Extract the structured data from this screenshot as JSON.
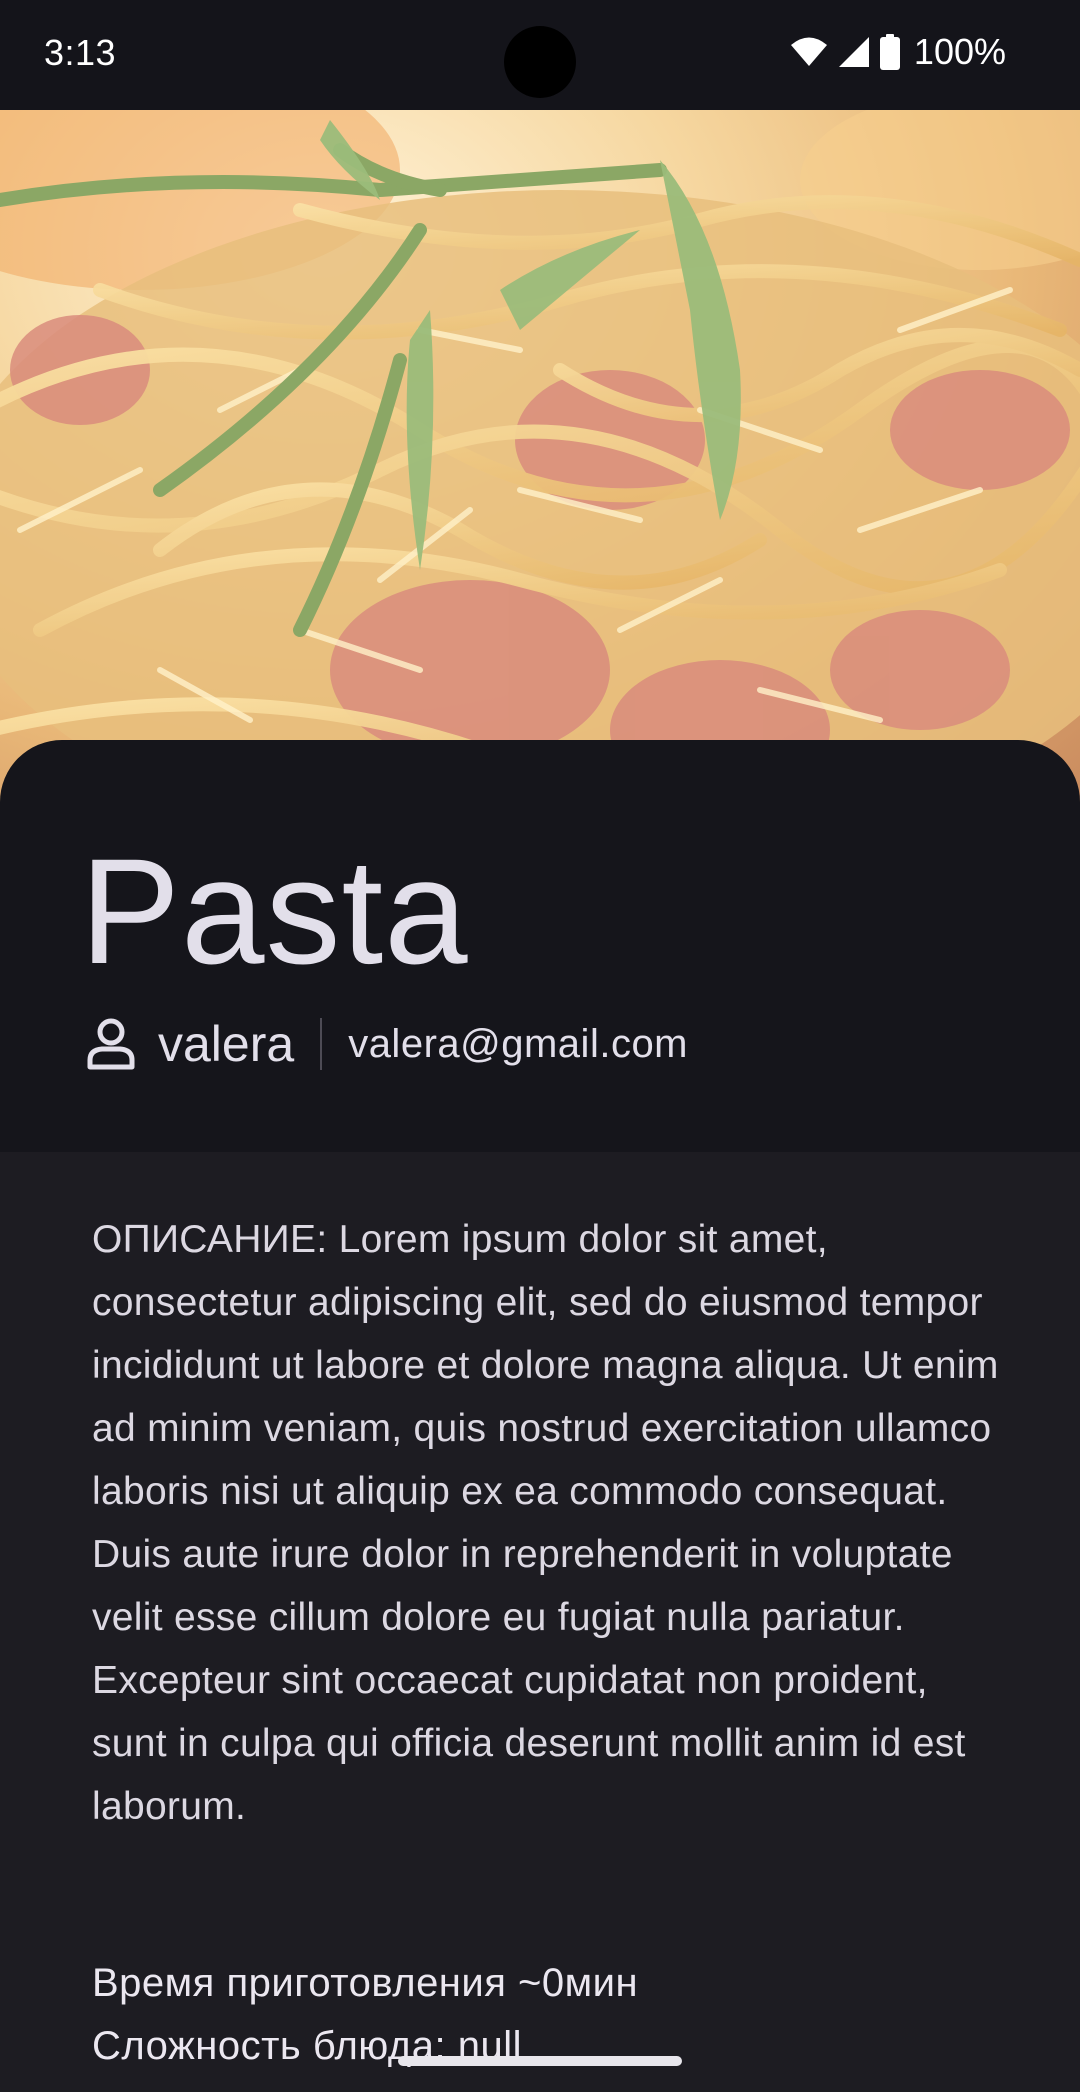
{
  "status_bar": {
    "time": "3:13",
    "battery": "100%",
    "icons": [
      "wifi-icon",
      "cell-signal-icon",
      "battery-icon"
    ]
  },
  "hero": {
    "image": "pasta-dish-photo"
  },
  "recipe": {
    "title": "Pasta",
    "author": {
      "icon": "user-icon",
      "name": "valera",
      "email": "valera@gmail.com"
    },
    "description": "ОПИСАНИЕ: Lorem ipsum dolor sit amet, consectetur adipiscing elit, sed do eiusmod tempor incididunt ut labore et dolore magna aliqua. Ut enim ad minim veniam, quis nostrud exercitation ullamco laboris nisi ut aliquip ex ea commodo consequat. Duis aute irure dolor in reprehenderit in voluptate velit esse cillum dolore eu fugiat nulla pariatur. Excepteur sint occaecat cupidatat non proident, sunt in culpa qui officia deserunt mollit anim id est laborum.",
    "cooking_time": "Время приготовления ~0мин",
    "difficulty": "Сложность блюда: null"
  },
  "colors": {
    "status_bar_bg": "#14141a",
    "header_bg": "#15151b",
    "body_bg": "#1d1c22",
    "text_primary": "#e2dfea"
  }
}
